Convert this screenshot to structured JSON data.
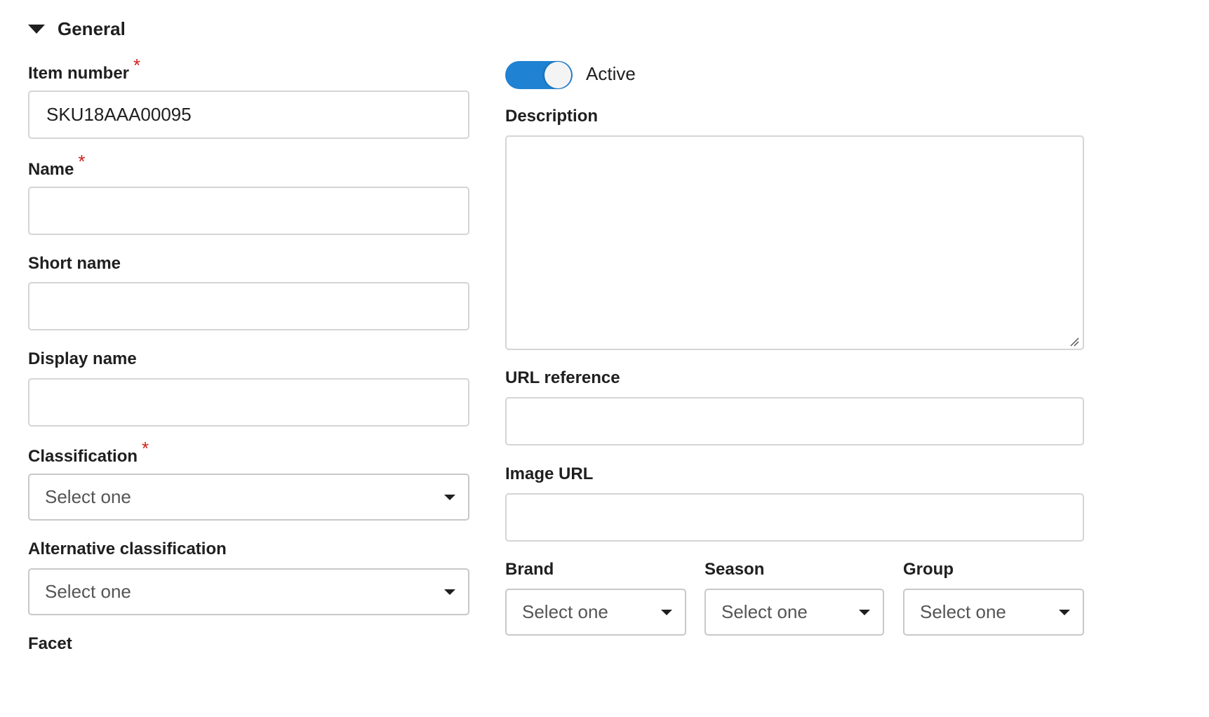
{
  "section": {
    "title": "General",
    "icon": "triangle-down-icon"
  },
  "colors": {
    "required_marker": "#d0211c",
    "toggle_on": "#1f82d2",
    "border": "#d5d5d5"
  },
  "left": {
    "item_number": {
      "label": "Item number",
      "required": "*",
      "value": "SKU18AAA00095"
    },
    "name": {
      "label": "Name",
      "required": "*",
      "value": ""
    },
    "short_name": {
      "label": "Short name",
      "value": ""
    },
    "display_name": {
      "label": "Display name",
      "value": ""
    },
    "classification": {
      "label": "Classification",
      "required": "*",
      "selected": "Select one"
    },
    "alt_classification": {
      "label": "Alternative classification",
      "selected": "Select one"
    },
    "facet": {
      "label": "Facet"
    }
  },
  "right": {
    "active": {
      "label": "Active",
      "state": "on"
    },
    "description": {
      "label": "Description",
      "value": ""
    },
    "url_reference": {
      "label": "URL reference",
      "value": ""
    },
    "image_url": {
      "label": "Image URL",
      "value": ""
    },
    "brand": {
      "label": "Brand",
      "selected": "Select one"
    },
    "season": {
      "label": "Season",
      "selected": "Select one"
    },
    "group": {
      "label": "Group",
      "selected": "Select one"
    }
  }
}
